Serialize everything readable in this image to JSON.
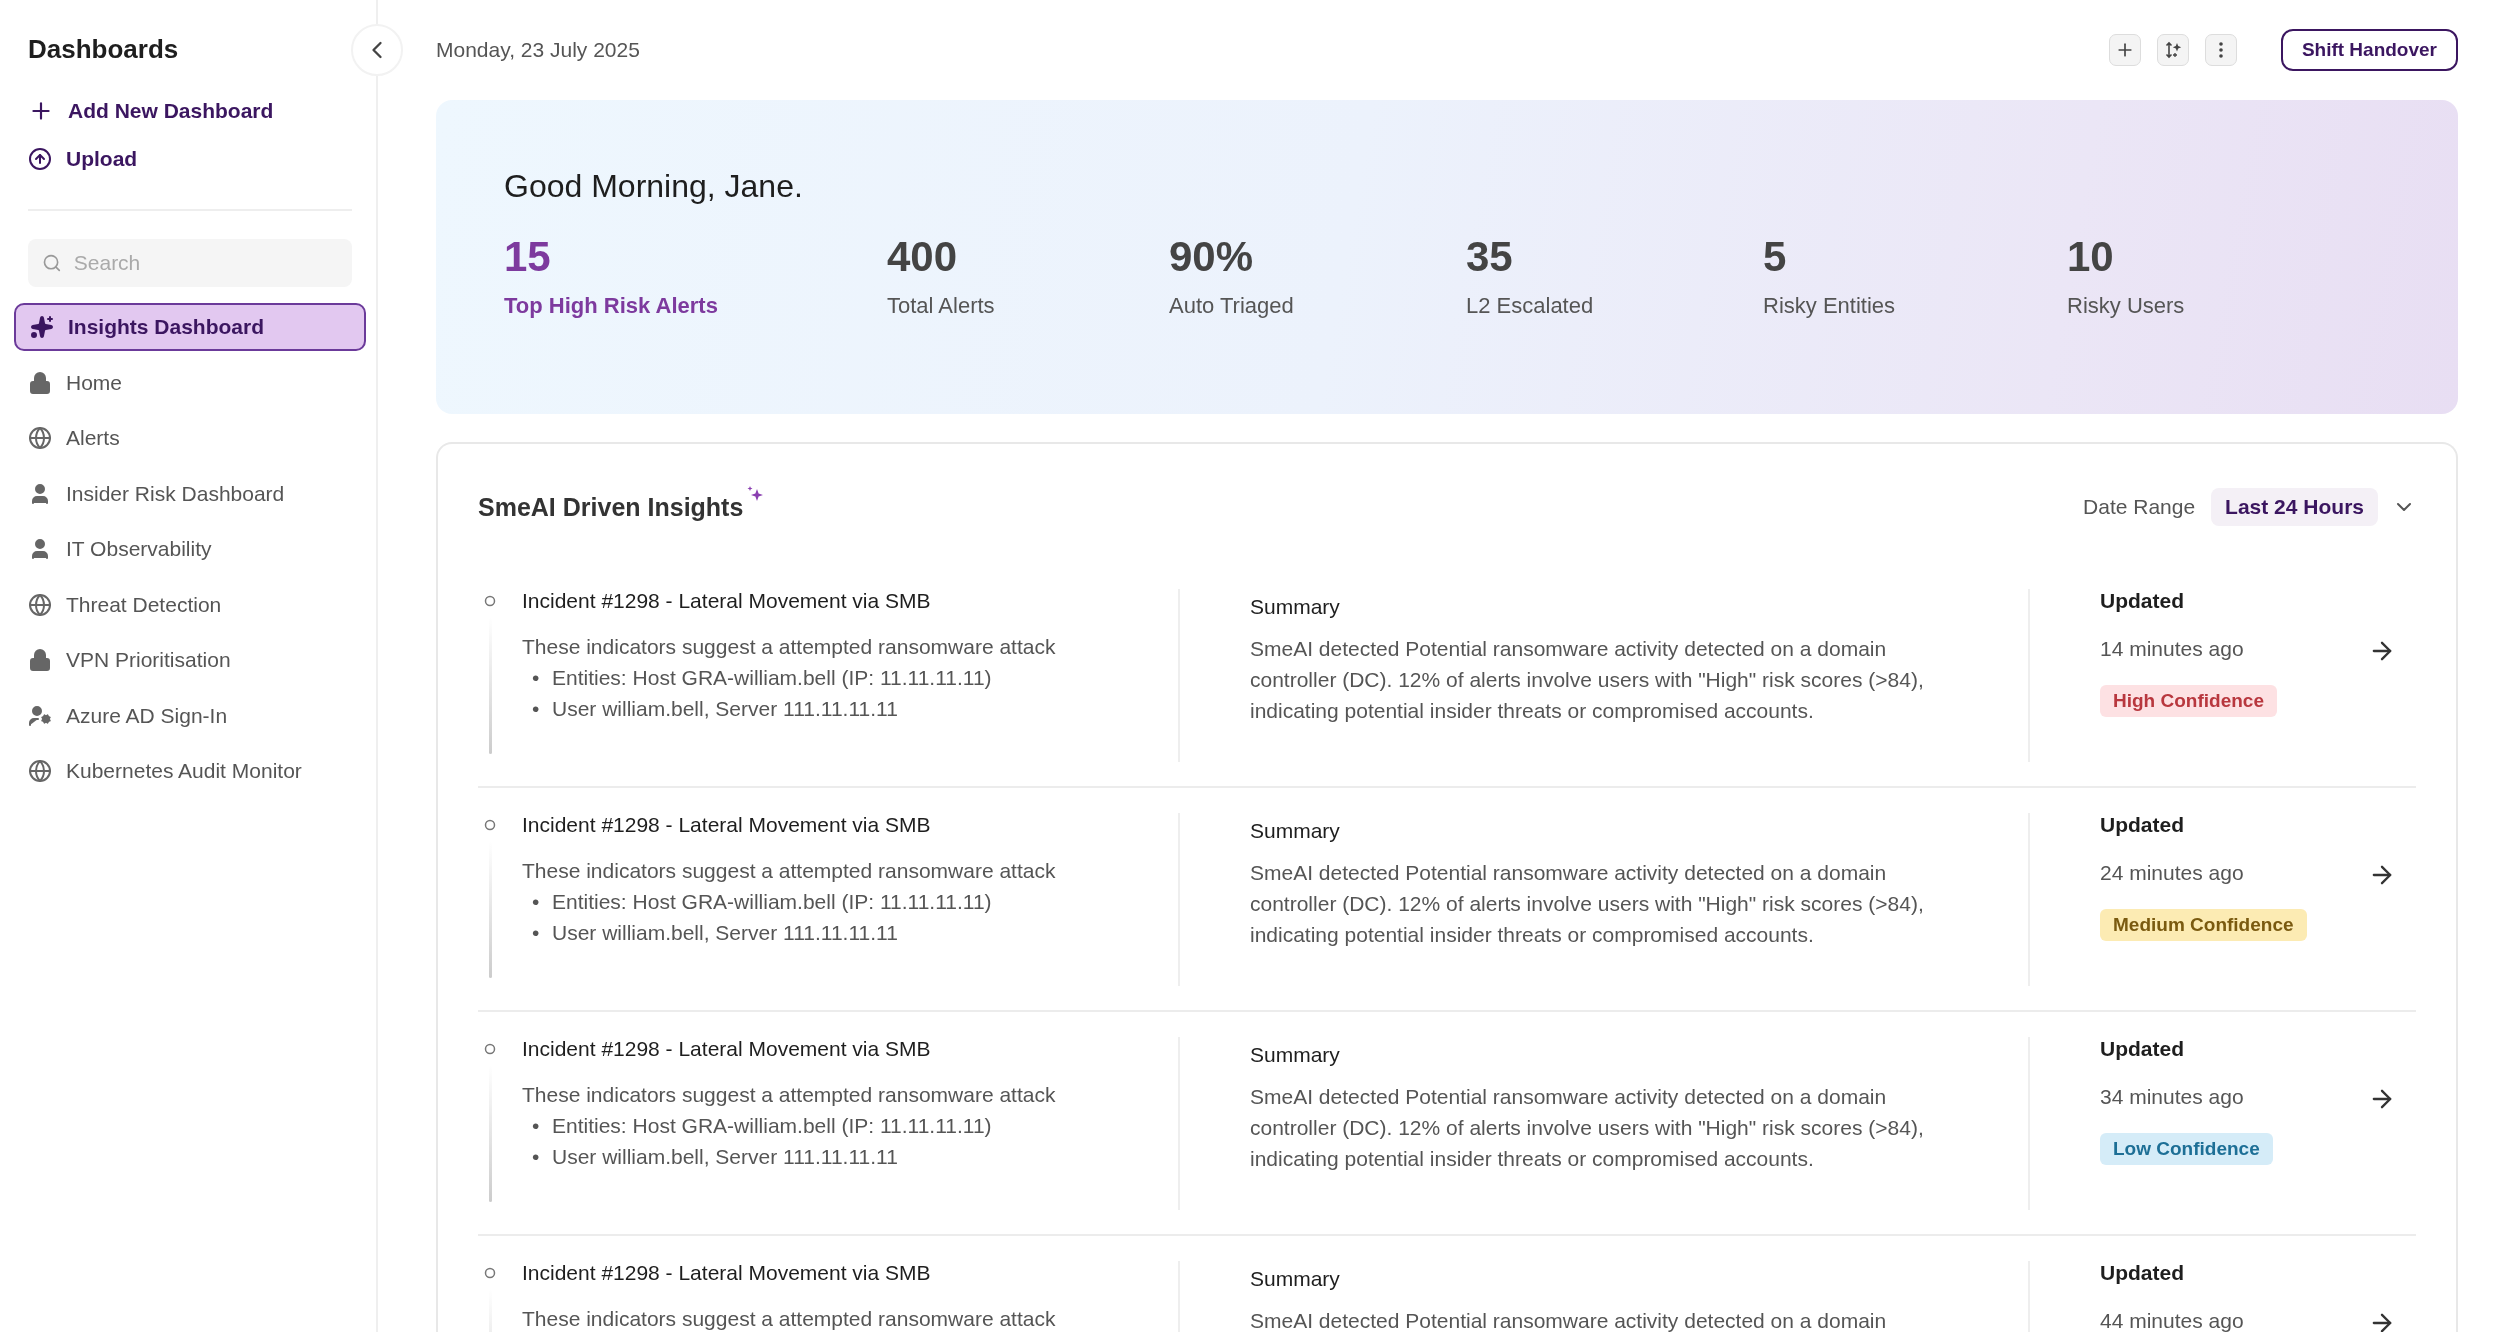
{
  "sidebar": {
    "title": "Dashboards",
    "actions": [
      {
        "label": "Add New Dashboard",
        "kind": "plus"
      },
      {
        "label": "Upload",
        "kind": "upload"
      }
    ],
    "search": {
      "placeholder": "Search"
    },
    "items": [
      {
        "label": "Insights Dashboard",
        "kind": "sparkle",
        "selected": true
      },
      {
        "label": "Home",
        "kind": "lock",
        "selected": false
      },
      {
        "label": "Alerts",
        "kind": "globe",
        "selected": false
      },
      {
        "label": "Insider Risk Dashboard",
        "kind": "user",
        "selected": false
      },
      {
        "label": "IT Observability",
        "kind": "user",
        "selected": false
      },
      {
        "label": "Threat Detection",
        "kind": "globe",
        "selected": false
      },
      {
        "label": "VPN Prioritisation",
        "kind": "lock",
        "selected": false
      },
      {
        "label": "Azure AD Sign-In",
        "kind": "user-gear",
        "selected": false
      },
      {
        "label": "Kubernetes Audit Monitor",
        "kind": "globe",
        "selected": false
      }
    ]
  },
  "header": {
    "date": "Monday, 23 July 2025",
    "button": "Shift Handover"
  },
  "hero": {
    "greeting": "Good Morning, Jane.",
    "stats": [
      {
        "value": "15",
        "label": "Top High Risk Alerts",
        "highlighted": true
      },
      {
        "value": "400",
        "label": "Total Alerts",
        "highlighted": false
      },
      {
        "value": "90%",
        "label": "Auto Triaged",
        "highlighted": false
      },
      {
        "value": "35",
        "label": "L2 Escalated",
        "highlighted": false
      },
      {
        "value": "5",
        "label": "Risky Entities",
        "highlighted": false
      },
      {
        "value": "10",
        "label": "Risky Users",
        "highlighted": false
      }
    ]
  },
  "insights": {
    "title": "SmeAI Driven Insights",
    "date_range_label": "Date Range",
    "date_range": "Last 24 Hours",
    "rows": [
      {
        "title": "Incident #1298 - Lateral Movement via SMB",
        "description": "These indicators suggest a attempted ransomware attack",
        "bullets": [
          {
            "marker": "•",
            "text": "Entities: Host GRA-william.bell (IP: 11.11.11.11)"
          },
          {
            "marker": "•",
            "text": "User william.bell, Server 111.11.11.11"
          }
        ],
        "summary_label": "Summary",
        "summary": "SmeAI detected Potential ransomware activity detected on a domain controller (DC). 12% of alerts involve users with \"High\" risk scores (>84), indicating potential insider threats or compromised accounts.",
        "updated_label": "Updated",
        "updated": "14 minutes ago",
        "confidence": {
          "label": "High Confidence",
          "color": "#fde1e3"
        }
      },
      {
        "title": "Incident #1298 - Lateral Movement via SMB",
        "description": "These indicators suggest a attempted ransomware attack",
        "bullets": [
          {
            "marker": "•",
            "text": "Entities: Host GRA-william.bell (IP: 11.11.11.11)"
          },
          {
            "marker": "•",
            "text": "User william.bell, Server 111.11.11.11"
          }
        ],
        "summary_label": "Summary",
        "summary": "SmeAI detected Potential ransomware activity detected on a domain controller (DC). 12% of alerts involve users with \"High\" risk scores (>84), indicating potential insider threats or compromised accounts.",
        "updated_label": "Updated",
        "updated": "24 minutes ago",
        "confidence": {
          "label": "Medium Confidence",
          "color": "#fcebb3"
        }
      },
      {
        "title": "Incident #1298 - Lateral Movement via SMB",
        "description": "These indicators suggest a attempted ransomware attack",
        "bullets": [
          {
            "marker": "•",
            "text": "Entities: Host GRA-william.bell (IP: 11.11.11.11)"
          },
          {
            "marker": "•",
            "text": "User william.bell, Server 111.11.11.11"
          }
        ],
        "summary_label": "Summary",
        "summary": "SmeAI detected Potential ransomware activity detected on a domain controller (DC). 12% of alerts involve users with \"High\" risk scores (>84), indicating potential insider threats or compromised accounts.",
        "updated_label": "Updated",
        "updated": "34 minutes ago",
        "confidence": {
          "label": "Low Confidence",
          "color": "#d5ecf8"
        }
      },
      {
        "title": "Incident #1298 - Lateral Movement via SMB",
        "description": "These indicators suggest a attempted ransomware attack",
        "summary_label": "Summary",
        "summary": "SmeAI detected Potential ransomware activity detected on a domain",
        "updated_label": "Updated",
        "updated": "44 minutes ago"
      }
    ]
  }
}
